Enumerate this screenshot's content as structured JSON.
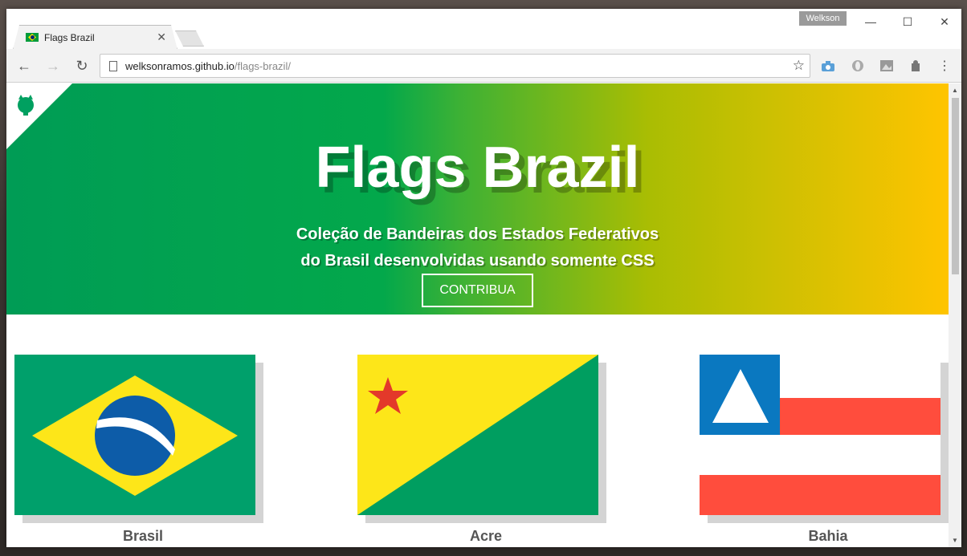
{
  "window": {
    "profile_name": "Welkson",
    "controls": [
      "minimize",
      "maximize",
      "close"
    ]
  },
  "tab": {
    "title": "Flags Brazil",
    "favicon": "brazil-flag-icon"
  },
  "toolbar": {
    "url_host": "welksonramos.github.io",
    "url_path": "/flags-brazil/",
    "icons": [
      "back-icon",
      "forward-icon",
      "reload-icon",
      "star-icon",
      "camera-icon",
      "opera-icon",
      "image-icon",
      "puzzle-icon",
      "menu-icon"
    ]
  },
  "hero": {
    "title": "Flags Brazil",
    "subtitle_line1": "Coleção de Bandeiras dos Estados Federativos",
    "subtitle_line2": "do Brasil desenvolvidas usando somente CSS",
    "cta_label": "CONTRIBUA",
    "colors": {
      "start": "#009c55",
      "end": "#ffc400"
    }
  },
  "flags": [
    {
      "name": "Brasil"
    },
    {
      "name": "Acre"
    },
    {
      "name": "Bahia"
    }
  ]
}
